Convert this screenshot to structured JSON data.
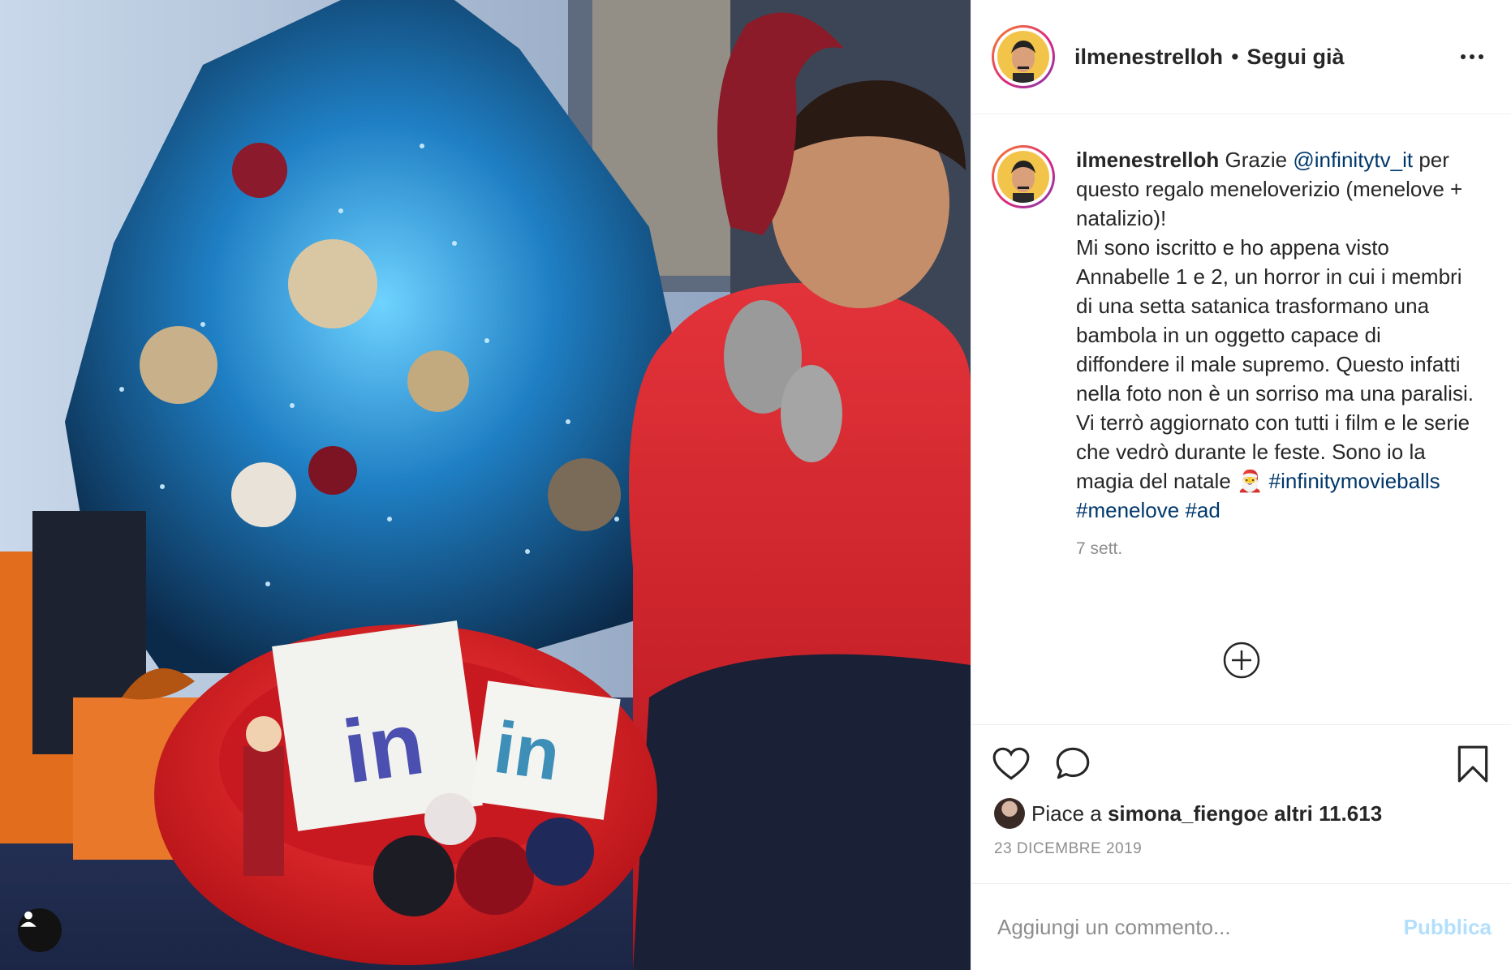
{
  "post": {
    "username": "ilmenestrelloh",
    "separator": "•",
    "follow_state": "Segui già",
    "more_icon": "more-horizontal-icon"
  },
  "caption": {
    "username": "ilmenestrelloh",
    "part1": "Grazie ",
    "mention": "@infinitytv_it",
    "part2": " per questo regalo meneloverizio (menelove + natalizio)!",
    "part3": "Mi sono iscritto e ho appena visto Annabelle 1 e 2, un horror in cui i membri di una setta satanica trasformano una bambola in un oggetto capace di diffondere il male supremo. Questo infatti nella foto non è un sorriso ma una paralisi. Vi terrò aggiornato con tutti i film e le serie che vedrò durante le feste. Sono io la magia del natale ",
    "emoji": "🎅",
    "hashtag1": "#infinitymovieballs",
    "hashtag2": "#menelove",
    "hashtag3": "#ad",
    "time": "7 sett."
  },
  "likes": {
    "prefix": "Piace a ",
    "user": "simona_fiengo",
    "middle": " e ",
    "others": "altri 11.613"
  },
  "date": "23 DICEMBRE 2019",
  "comment_input": {
    "placeholder": "Aggiungi un commento...",
    "publish_label": "Pubblica"
  },
  "colors": {
    "link": "#00376b",
    "muted": "#8e8e8e",
    "publish_disabled": "#b2dffc"
  }
}
